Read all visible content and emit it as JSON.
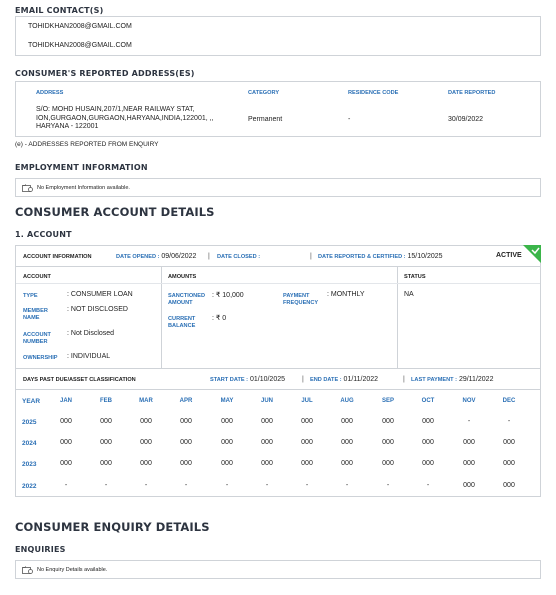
{
  "email_section": {
    "title": "EMAIL CONTACT(S)",
    "emails": [
      "TOHIDKHAN2008@GMAIL.COM",
      "TOHIDKHAN2008@GMAIL.COM"
    ]
  },
  "address_section": {
    "title": "CONSUMER'S REPORTED ADDRESS(ES)",
    "headers": {
      "address": "ADDRESS",
      "category": "CATEGORY",
      "residence_code": "RESIDENCE CODE",
      "date_reported": "DATE REPORTED"
    },
    "rows": [
      {
        "address_line1": "S/O: MOHD HUSAIN,207/1,NEAR RAILWAY STAT,",
        "address_line2": "ION,GURGAON,GURGAON,HARYANA,INDIA,122001, ,,",
        "address_line3": "HARYANA - 122001",
        "category": "Permanent",
        "residence_code": "-",
        "date_reported": "30/09/2022"
      }
    ],
    "footnote": "(e) - ADDRESSES REPORTED FROM ENQUIRY"
  },
  "employment_section": {
    "title": "EMPLOYMENT INFORMATION",
    "message": "No Employment Information available."
  },
  "account_details": {
    "title": "CONSUMER ACCOUNT DETAILS",
    "account_heading": "1. ACCOUNT",
    "info_bar": {
      "label": "ACCOUNT INFORMATION",
      "date_opened_label": "DATE OPENED :",
      "date_opened": "09/06/2022",
      "date_closed_label": "DATE CLOSED :",
      "date_closed": "",
      "date_reported_label": "DATE REPORTED & CERTIFIED :",
      "date_reported": "15/10/2025",
      "status_badge": "ACTIVE"
    },
    "account": {
      "header": "ACCOUNT",
      "type_label": "TYPE",
      "type": "CONSUMER LOAN",
      "member_name_label_1": "MEMBER",
      "member_name_label_2": "NAME",
      "member_name": "NOT DISCLOSED",
      "account_number_label_1": "ACCOUNT",
      "account_number_label_2": "NUMBER",
      "account_number": "Not Disclosed",
      "ownership_label": "OWNERSHIP",
      "ownership": "INDIVIDUAL"
    },
    "amounts": {
      "header": "AMOUNTS",
      "sanctioned_label_1": "SANCTIONED",
      "sanctioned_label_2": "AMOUNT",
      "sanctioned": "₹ 10,000",
      "current_label_1": "CURRENT",
      "current_label_2": "BALANCE",
      "current": "₹ 0",
      "payment_frequency_label_1": "PAYMENT",
      "payment_frequency_label_2": "FREQUENCY",
      "payment_frequency": "MONTHLY"
    },
    "status": {
      "header": "STATUS",
      "value": "NA"
    },
    "dpd": {
      "label": "DAYS PAST DUE/ASSET CLASSIFICATION",
      "start_date_label": "START DATE :",
      "start_date": "01/10/2025",
      "end_date_label": "END DATE :",
      "end_date": "01/11/2022",
      "last_payment_label": "LAST PAYMENT :",
      "last_payment": "29/11/2022",
      "year_label": "YEAR",
      "months": [
        "JAN",
        "FEB",
        "MAR",
        "APR",
        "MAY",
        "JUN",
        "JUL",
        "AUG",
        "SEP",
        "OCT",
        "NOV",
        "DEC"
      ],
      "rows": [
        {
          "year": "2025",
          "values": [
            "000",
            "000",
            "000",
            "000",
            "000",
            "000",
            "000",
            "000",
            "000",
            "000",
            "-",
            "-"
          ]
        },
        {
          "year": "2024",
          "values": [
            "000",
            "000",
            "000",
            "000",
            "000",
            "000",
            "000",
            "000",
            "000",
            "000",
            "000",
            "000"
          ]
        },
        {
          "year": "2023",
          "values": [
            "000",
            "000",
            "000",
            "000",
            "000",
            "000",
            "000",
            "000",
            "000",
            "000",
            "000",
            "000"
          ]
        },
        {
          "year": "2022",
          "values": [
            "-",
            "-",
            "-",
            "-",
            "-",
            "-",
            "-",
            "-",
            "-",
            "-",
            "000",
            "000"
          ]
        }
      ]
    }
  },
  "enquiry_section": {
    "title": "CONSUMER ENQUIRY DETAILS",
    "subtitle": "ENQUIRIES",
    "message": "No Enquiry Details available."
  },
  "colors": {
    "accent_blue": "#2a6fb5",
    "active_green": "#3bb54a",
    "border": "#cfd3d8"
  }
}
